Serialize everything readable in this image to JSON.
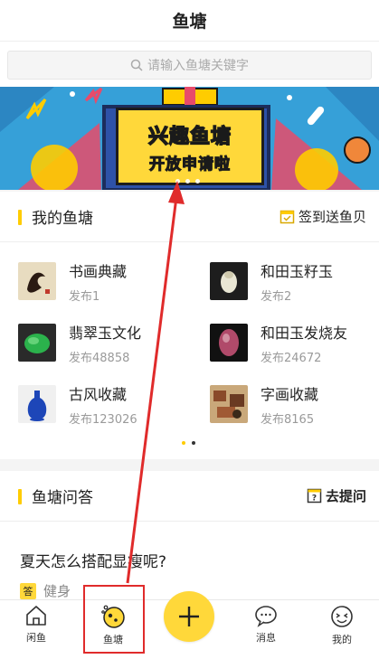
{
  "header": {
    "title": "鱼塘"
  },
  "search": {
    "placeholder": "请输入鱼塘关键字"
  },
  "banner": {
    "line1": "兴趣鱼塘",
    "line2": "开放申请啦"
  },
  "my_ponds": {
    "title": "我的鱼塘",
    "action": "签到送鱼贝",
    "items": [
      {
        "name": "书画典藏",
        "count": "发布1"
      },
      {
        "name": "和田玉籽玉",
        "count": "发布2"
      },
      {
        "name": "翡翠玉文化",
        "count": "发布48858"
      },
      {
        "name": "和田玉发烧友",
        "count": "发布24672"
      },
      {
        "name": "古风收藏",
        "count": "发布123026"
      },
      {
        "name": "字画收藏",
        "count": "发布8165"
      }
    ]
  },
  "qa": {
    "title": "鱼塘问答",
    "action": "去提问",
    "question": "夏天怎么搭配显瘦呢?",
    "tag_badge": "答",
    "tag_name": "健身"
  },
  "tabbar": {
    "items": [
      {
        "label": "闲鱼",
        "icon": "house-icon"
      },
      {
        "label": "鱼塘",
        "icon": "fishpond-icon"
      },
      {
        "label": "",
        "icon": "plus-icon"
      },
      {
        "label": "消息",
        "icon": "chat-bubble-icon"
      },
      {
        "label": "我的",
        "icon": "face-icon"
      }
    ]
  },
  "colors": {
    "accent": "#ffd83a",
    "annotation": "#e02b2b",
    "banner_bg": "#36a0d8"
  }
}
